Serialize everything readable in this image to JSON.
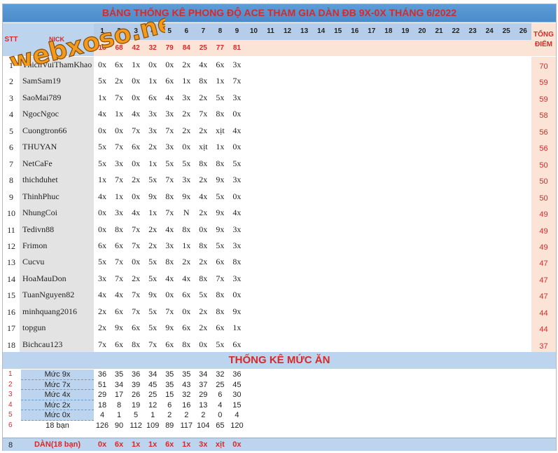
{
  "title": "BẢNG THỐNG KÊ PHONG ĐỘ ACE THAM GIA DÀN ĐB 9X-0X THÁNG 6/2022",
  "watermark": "webxoso.net",
  "headers": {
    "stt": "STT",
    "nick": "NICK",
    "tong": [
      "TỔNG",
      "ĐIỂM"
    ]
  },
  "days": [
    "1",
    "2",
    "3",
    "4",
    "5",
    "6",
    "7",
    "8",
    "9",
    "10",
    "11",
    "12",
    "13",
    "14",
    "15",
    "16",
    "17",
    "18",
    "19",
    "20",
    "21",
    "22",
    "23",
    "24",
    "25",
    "26"
  ],
  "counts": [
    "18",
    "68",
    "42",
    "32",
    "79",
    "84",
    "25",
    "77",
    "81"
  ],
  "players": [
    {
      "stt": "1",
      "nick": "ThichVuiThamKhao",
      "vals": [
        "0x",
        "6x",
        "1x",
        "0x",
        "0x",
        "2x",
        "4x",
        "6x",
        "3x"
      ],
      "total": "70"
    },
    {
      "stt": "2",
      "nick": "SamSam19",
      "vals": [
        "5x",
        "2x",
        "0x",
        "1x",
        "6x",
        "1x",
        "8x",
        "1x",
        "7x"
      ],
      "total": "59"
    },
    {
      "stt": "3",
      "nick": "SaoMai789",
      "vals": [
        "1x",
        "7x",
        "0x",
        "6x",
        "4x",
        "3x",
        "2x",
        "5x",
        "3x"
      ],
      "total": "59"
    },
    {
      "stt": "4",
      "nick": "NgocNgoc",
      "vals": [
        "4x",
        "1x",
        "4x",
        "3x",
        "3x",
        "2x",
        "7x",
        "8x",
        "0x"
      ],
      "total": "58"
    },
    {
      "stt": "5",
      "nick": "Cuongtron66",
      "vals": [
        "0x",
        "0x",
        "7x",
        "3x",
        "7x",
        "2x",
        "2x",
        "xịt",
        "4x"
      ],
      "total": "56"
    },
    {
      "stt": "6",
      "nick": "THUYAN",
      "vals": [
        "5x",
        "7x",
        "6x",
        "2x",
        "3x",
        "0x",
        "xịt",
        "1x",
        "0x"
      ],
      "total": "56"
    },
    {
      "stt": "7",
      "nick": "NetCaFe",
      "vals": [
        "5x",
        "3x",
        "0x",
        "1x",
        "5x",
        "5x",
        "8x",
        "8x",
        "5x"
      ],
      "total": "50"
    },
    {
      "stt": "8",
      "nick": "thichduhet",
      "vals": [
        "1x",
        "7x",
        "2x",
        "5x",
        "7x",
        "3x",
        "2x",
        "9x",
        "3x"
      ],
      "total": "50"
    },
    {
      "stt": "9",
      "nick": "ThinhPhuc",
      "vals": [
        "4x",
        "1x",
        "0x",
        "9x",
        "8x",
        "9x",
        "4x",
        "5x",
        "0x"
      ],
      "total": "50"
    },
    {
      "stt": "10",
      "nick": "NhungCoi",
      "vals": [
        "0x",
        "3x",
        "4x",
        "1x",
        "7x",
        "N",
        "2x",
        "9x",
        "4x"
      ],
      "total": "49"
    },
    {
      "stt": "11",
      "nick": "Tedivn88",
      "vals": [
        "0x",
        "8x",
        "7x",
        "2x",
        "4x",
        "8x",
        "0x",
        "9x",
        "3x"
      ],
      "total": "49"
    },
    {
      "stt": "12",
      "nick": "Frimon",
      "vals": [
        "6x",
        "6x",
        "7x",
        "2x",
        "3x",
        "1x",
        "8x",
        "5x",
        "3x"
      ],
      "total": "49"
    },
    {
      "stt": "13",
      "nick": "Cucvu",
      "vals": [
        "5x",
        "7x",
        "0x",
        "5x",
        "8x",
        "2x",
        "2x",
        "6x",
        "8x"
      ],
      "total": "47"
    },
    {
      "stt": "14",
      "nick": "HoaMauDon",
      "vals": [
        "3x",
        "7x",
        "2x",
        "5x",
        "4x",
        "4x",
        "8x",
        "7x",
        "3x"
      ],
      "total": "47"
    },
    {
      "stt": "15",
      "nick": "TuanNguyen82",
      "vals": [
        "4x",
        "4x",
        "7x",
        "9x",
        "0x",
        "6x",
        "5x",
        "8x",
        "0x"
      ],
      "total": "47"
    },
    {
      "stt": "16",
      "nick": "minhquang2016",
      "vals": [
        "2x",
        "6x",
        "7x",
        "5x",
        "7x",
        "0x",
        "2x",
        "8x",
        "9x"
      ],
      "total": "44"
    },
    {
      "stt": "17",
      "nick": "topgun",
      "vals": [
        "2x",
        "9x",
        "6x",
        "5x",
        "9x",
        "6x",
        "2x",
        "6x",
        "1x"
      ],
      "total": "44"
    },
    {
      "stt": "18",
      "nick": "Bichcau123",
      "vals": [
        "7x",
        "6x",
        "8x",
        "7x",
        "6x",
        "8x",
        "0x",
        "5x",
        "6x"
      ],
      "total": "37"
    }
  ],
  "section2": {
    "title": "THỐNG KÊ MỨC ĂN",
    "rows": [
      {
        "stt": "1",
        "label": "Mức 9x",
        "vals": [
          "36",
          "35",
          "36",
          "34",
          "35",
          "35",
          "34",
          "32",
          "36"
        ]
      },
      {
        "stt": "2",
        "label": "Mức 7x",
        "vals": [
          "51",
          "34",
          "39",
          "45",
          "35",
          "43",
          "37",
          "25",
          "45"
        ]
      },
      {
        "stt": "3",
        "label": "Mức 4x",
        "vals": [
          "29",
          "17",
          "26",
          "25",
          "15",
          "32",
          "29",
          "6",
          "30"
        ]
      },
      {
        "stt": "4",
        "label": "Mức 2x",
        "vals": [
          "18",
          "8",
          "19",
          "12",
          "6",
          "16",
          "13",
          "4",
          "15"
        ]
      },
      {
        "stt": "5",
        "label": "Mức 0x",
        "vals": [
          "4",
          "1",
          "5",
          "1",
          "2",
          "2",
          "2",
          "0",
          "4"
        ]
      },
      {
        "stt": "6",
        "label": "18 bạn",
        "vals": [
          "126",
          "90",
          "112",
          "109",
          "89",
          "117",
          "104",
          "65",
          "120"
        ]
      }
    ],
    "dan": {
      "stt": "8",
      "label": "DÀN(18 bạn)",
      "vals": [
        "0x",
        "6x",
        "1x",
        "1x",
        "6x",
        "1x",
        "3x",
        "xịt",
        "0x"
      ]
    }
  }
}
